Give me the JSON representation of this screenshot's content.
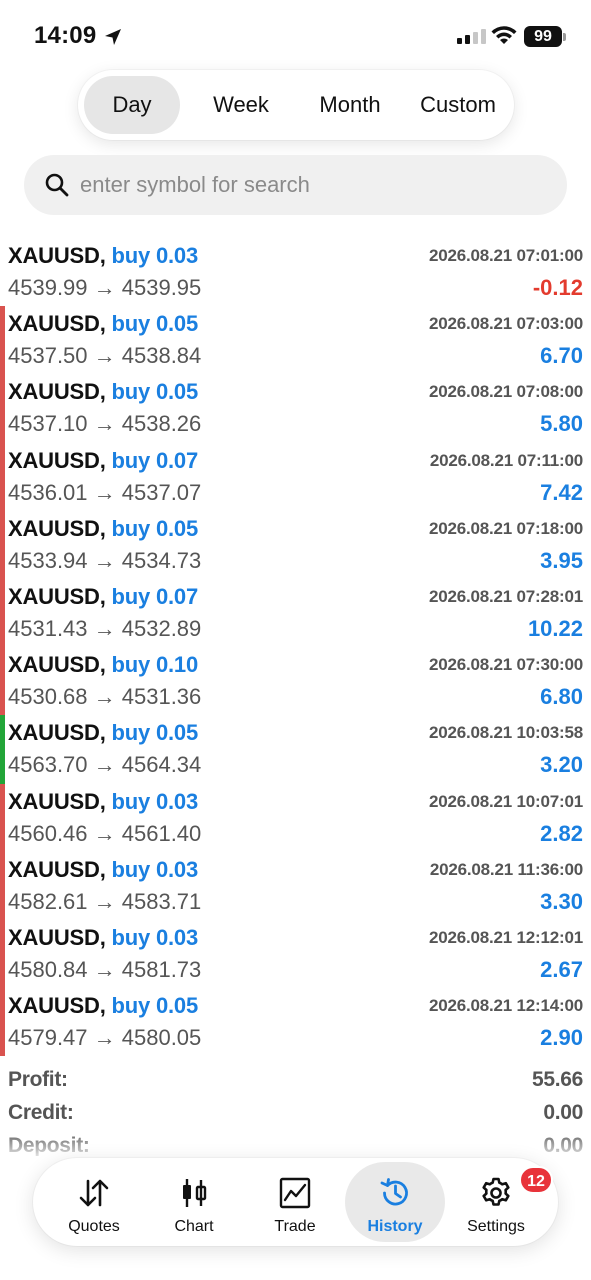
{
  "status_bar": {
    "time": "14:09",
    "battery": "99"
  },
  "periods": {
    "items": [
      "Day",
      "Week",
      "Month",
      "Custom"
    ],
    "active": "Day"
  },
  "search": {
    "placeholder": "enter symbol for search",
    "value": ""
  },
  "trades": [
    {
      "symbol": "XAUUSD,",
      "type": "buy 0.03",
      "time": "2026.08.21 07:01:00",
      "prices": "4539.99 → 4539.95",
      "profit": "-0.12",
      "negative": true,
      "bar_color": "none"
    },
    {
      "symbol": "XAUUSD,",
      "type": "buy 0.05",
      "time": "2026.08.21 07:03:00",
      "prices": "4537.50 → 4538.84",
      "profit": "6.70",
      "negative": false,
      "bar_color": "#d9534f"
    },
    {
      "symbol": "XAUUSD,",
      "type": "buy 0.05",
      "time": "2026.08.21 07:08:00",
      "prices": "4537.10 → 4538.26",
      "profit": "5.80",
      "negative": false,
      "bar_color": "#d9534f"
    },
    {
      "symbol": "XAUUSD,",
      "type": "buy 0.07",
      "time": "2026.08.21 07:11:00",
      "prices": "4536.01 → 4537.07",
      "profit": "7.42",
      "negative": false,
      "bar_color": "#d9534f"
    },
    {
      "symbol": "XAUUSD,",
      "type": "buy 0.05",
      "time": "2026.08.21 07:18:00",
      "prices": "4533.94 → 4534.73",
      "profit": "3.95",
      "negative": false,
      "bar_color": "#d9534f"
    },
    {
      "symbol": "XAUUSD,",
      "type": "buy 0.07",
      "time": "2026.08.21 07:28:01",
      "prices": "4531.43 → 4532.89",
      "profit": "10.22",
      "negative": false,
      "bar_color": "#d9534f"
    },
    {
      "symbol": "XAUUSD,",
      "type": "buy 0.10",
      "time": "2026.08.21 07:30:00",
      "prices": "4530.68 → 4531.36",
      "profit": "6.80",
      "negative": false,
      "bar_color": "#d9534f"
    },
    {
      "symbol": "XAUUSD,",
      "type": "buy 0.05",
      "time": "2026.08.21 10:03:58",
      "prices": "4563.70 → 4564.34",
      "profit": "3.20",
      "negative": false,
      "bar_color": "#22a538"
    },
    {
      "symbol": "XAUUSD,",
      "type": "buy 0.03",
      "time": "2026.08.21 10:07:01",
      "prices": "4560.46 → 4561.40",
      "profit": "2.82",
      "negative": false,
      "bar_color": "#d9534f"
    },
    {
      "symbol": "XAUUSD,",
      "type": "buy 0.03",
      "time": "2026.08.21 11:36:00",
      "prices": "4582.61 → 4583.71",
      "profit": "3.30",
      "negative": false,
      "bar_color": "#d9534f"
    },
    {
      "symbol": "XAUUSD,",
      "type": "buy 0.03",
      "time": "2026.08.21 12:12:01",
      "prices": "4580.84 → 4581.73",
      "profit": "2.67",
      "negative": false,
      "bar_color": "#d9534f"
    },
    {
      "symbol": "XAUUSD,",
      "type": "buy 0.05",
      "time": "2026.08.21 12:14:00",
      "prices": "4579.47 → 4580.05",
      "profit": "2.90",
      "negative": false,
      "bar_color": "#d9534f"
    }
  ],
  "summary": [
    {
      "label": "Profit:",
      "value": "55.66"
    },
    {
      "label": "Credit:",
      "value": "0.00"
    },
    {
      "label": "Deposit:",
      "value": "0.00"
    }
  ],
  "tabbar": {
    "items": [
      {
        "label": "Quotes",
        "icon": "quotes-arrows-icon"
      },
      {
        "label": "Chart",
        "icon": "candlestick-chart-icon"
      },
      {
        "label": "Trade",
        "icon": "trade-line-chart-icon"
      },
      {
        "label": "History",
        "icon": "history-clock-icon"
      },
      {
        "label": "Settings",
        "icon": "gear-icon"
      }
    ],
    "active": "History",
    "settings_badge": "12"
  },
  "colors": {
    "accent": "#1a7fe0",
    "negative": "#e33b2e",
    "badge": "#e8333a"
  }
}
